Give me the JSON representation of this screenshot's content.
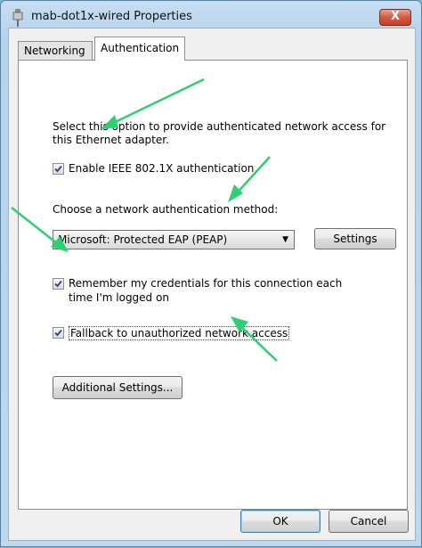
{
  "window": {
    "title": "mab-dot1x-wired Properties",
    "close_glyph": "X"
  },
  "tabs": [
    {
      "label": "Networking",
      "active": false
    },
    {
      "label": "Authentication",
      "active": true
    }
  ],
  "auth": {
    "intro_line1": "Select this option to provide authenticated network access for",
    "intro_line2": "this Ethernet adapter.",
    "enable_8021x": {
      "label": "Enable IEEE 802.1X authentication",
      "checked": true
    },
    "method_label": "Choose a network authentication method:",
    "method_value": "Microsoft: Protected EAP (PEAP)",
    "settings_button": "Settings",
    "remember_creds": {
      "line1": "Remember my credentials for this connection each",
      "line2": "time I'm logged on",
      "checked": true
    },
    "fallback": {
      "label": "Fallback to unauthorized network access",
      "checked": true
    },
    "additional_settings_button": "Additional Settings..."
  },
  "footer": {
    "ok_button": "OK",
    "cancel_button": "Cancel"
  },
  "colors": {
    "annotation_arrow": "#2ecf73",
    "title_bar": "#bcd7ee",
    "close_button": "#c94a33"
  }
}
